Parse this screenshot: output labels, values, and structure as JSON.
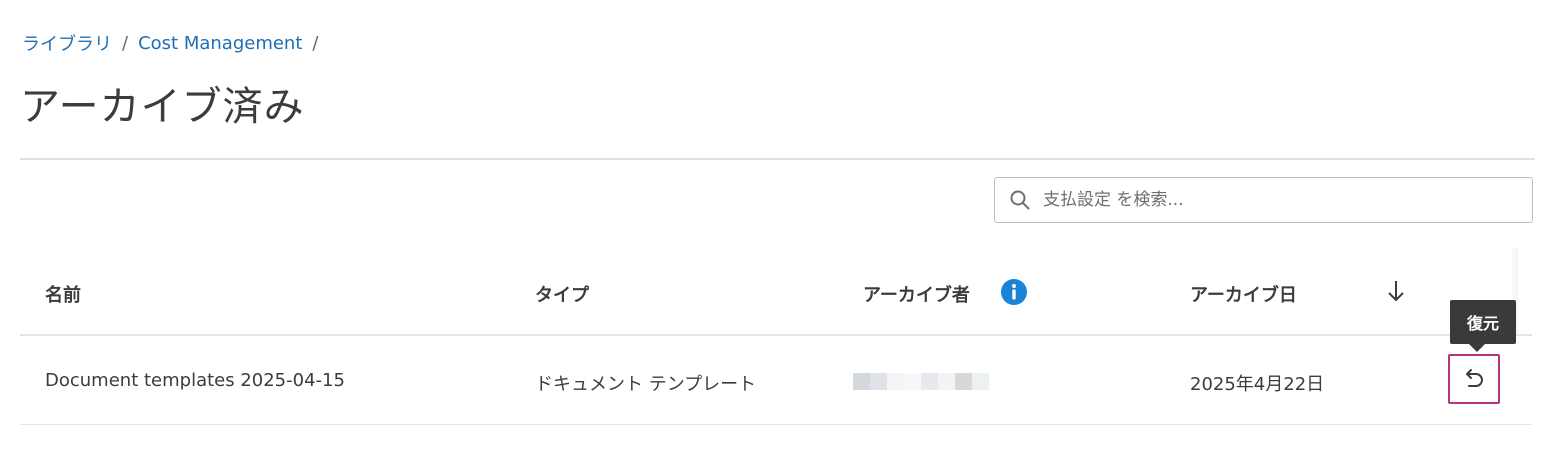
{
  "breadcrumb": {
    "items": [
      "ライブラリ",
      "Cost Management"
    ],
    "separator": "/"
  },
  "page": {
    "title": "アーカイブ済み"
  },
  "search": {
    "placeholder": "支払設定 を検索..."
  },
  "table": {
    "columns": {
      "name": "名前",
      "type": "タイプ",
      "archived_by": "アーカイブ者",
      "archived_date": "アーカイブ日"
    },
    "rows": [
      {
        "name": "Document templates 2025-04-15",
        "type": "ドキュメント テンプレート",
        "archived_by": "",
        "archived_date": "2025年4月22日"
      }
    ]
  },
  "actions": {
    "restore_tooltip": "復元"
  },
  "icons": {
    "search": "search-icon",
    "info": "info-icon",
    "sort": "arrow-down-icon",
    "restore": "undo-icon"
  },
  "colors": {
    "link": "#1f6fb5",
    "info": "#1a83d6",
    "highlight_border": "#b5357a",
    "tooltip_bg": "#3a3a3a"
  }
}
